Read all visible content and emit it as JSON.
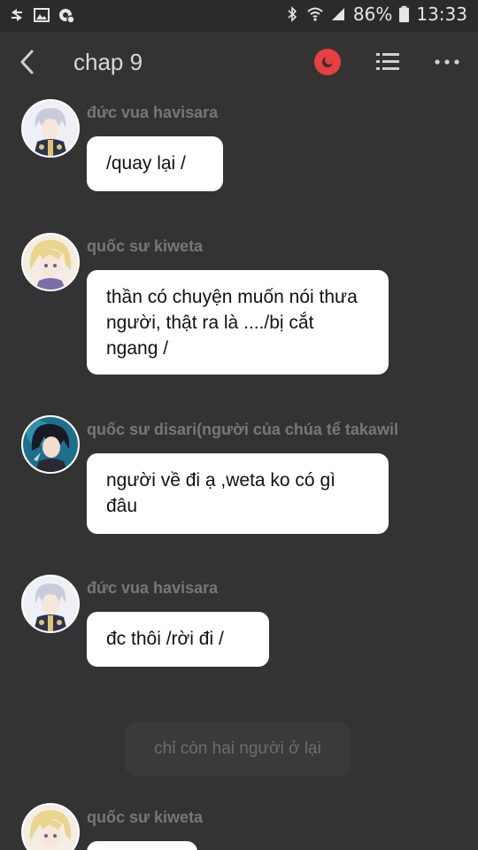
{
  "status_bar": {
    "battery": "86%",
    "time": "13:33",
    "icons_left": [
      "data-sync-icon",
      "image-icon",
      "settings-notification-icon"
    ],
    "icons_right": [
      "bluetooth-icon",
      "wifi-icon",
      "signal-icon",
      "battery-icon"
    ]
  },
  "header": {
    "title": "chap 9"
  },
  "messages": [
    {
      "sender": "đức vua havisara",
      "text": "/quay lại /",
      "avatar": "white-hair-king-avatar"
    },
    {
      "sender": "quốc sư kiweta",
      "text": "thần có chuyện muốn nói thưa người, thật ra là ..../bị cắt ngang /",
      "avatar": "blonde-avatar"
    },
    {
      "sender": "quốc sư disari(người của chúa tể takawil",
      "text": "người về đi ạ ,weta ko có gì đâu",
      "avatar": "dark-hair-avatar"
    },
    {
      "sender": "đức vua havisara",
      "text": "đc thôi /rời đi /",
      "avatar": "white-hair-king-avatar"
    },
    {
      "sender": "quốc sư kiweta",
      "text": "",
      "avatar": "blonde-avatar"
    }
  ],
  "system_message": "chỉ còn hai người ở lại",
  "colors": {
    "background": "#333333",
    "bubble": "#ffffff",
    "sender_text": "#777777",
    "accent_record": "#e8403f"
  }
}
